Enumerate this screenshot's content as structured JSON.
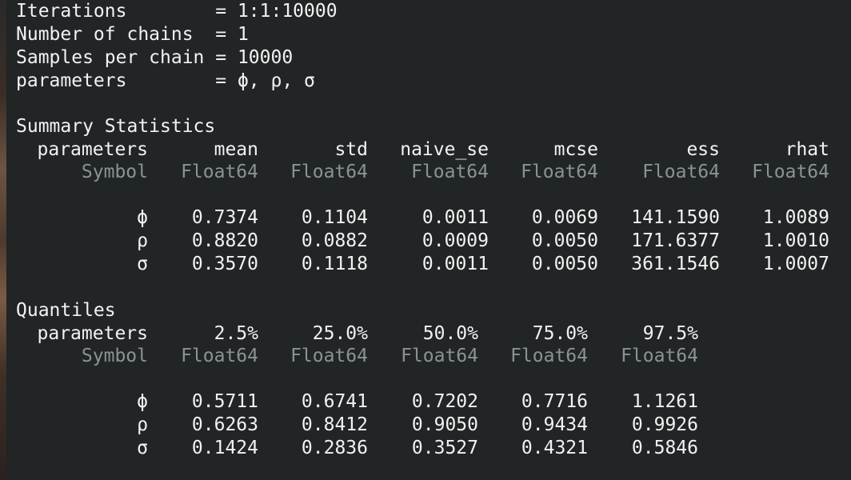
{
  "header": {
    "lines": [
      "Iterations        = 1:1:10000",
      "Number of chains  = 1",
      "Samples per chain = 10000",
      "parameters        = ϕ, ρ, σ"
    ]
  },
  "summary": {
    "title": "Summary Statistics",
    "columns": [
      "parameters",
      "mean",
      "std",
      "naive_se",
      "mcse",
      "ess",
      "rhat"
    ],
    "types": [
      "Symbol",
      "Float64",
      "Float64",
      "Float64",
      "Float64",
      "Float64",
      "Float64"
    ],
    "rows": [
      [
        "ϕ",
        "0.7374",
        "0.1104",
        "0.0011",
        "0.0069",
        "141.1590",
        "1.0089"
      ],
      [
        "ρ",
        "0.8820",
        "0.0882",
        "0.0009",
        "0.0050",
        "171.6377",
        "1.0010"
      ],
      [
        "σ",
        "0.3570",
        "0.1118",
        "0.0011",
        "0.0050",
        "361.1546",
        "1.0007"
      ]
    ]
  },
  "quantiles": {
    "title": "Quantiles",
    "columns": [
      "parameters",
      "2.5%",
      "25.0%",
      "50.0%",
      "75.0%",
      "97.5%"
    ],
    "types": [
      "Symbol",
      "Float64",
      "Float64",
      "Float64",
      "Float64",
      "Float64"
    ],
    "rows": [
      [
        "ϕ",
        "0.5711",
        "0.6741",
        "0.7202",
        "0.7716",
        "1.1261"
      ],
      [
        "ρ",
        "0.6263",
        "0.8412",
        "0.9050",
        "0.9434",
        "0.9926"
      ],
      [
        "σ",
        "0.1424",
        "0.2836",
        "0.3527",
        "0.4321",
        "0.5846"
      ]
    ]
  },
  "colors": {
    "terminal_bg": "#222526",
    "text": "#f2f2f2",
    "dim_text": "#8c9293"
  }
}
